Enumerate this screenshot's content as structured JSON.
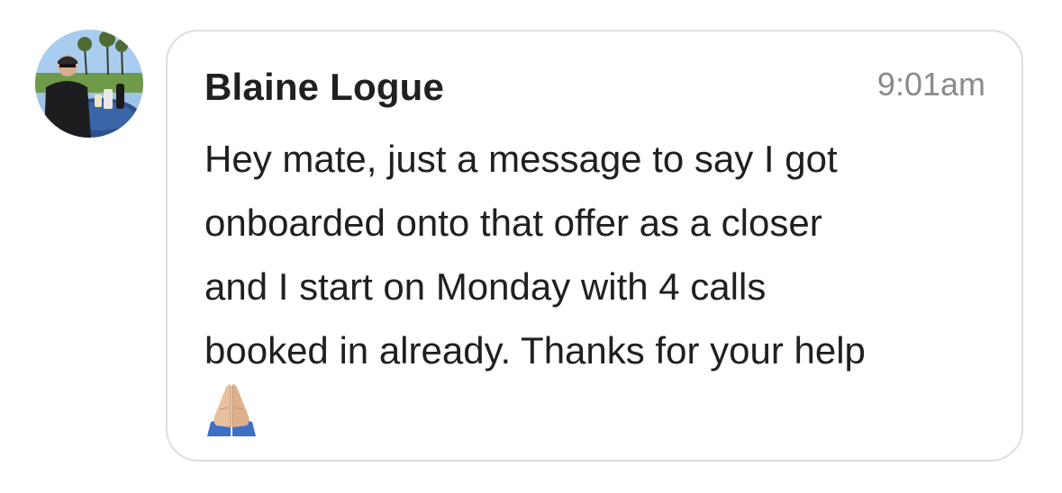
{
  "message": {
    "sender_name": "Blaine Logue",
    "timestamp": "9:01am",
    "text_lines": [
      "Hey mate, just a message to say I got",
      "onboarded onto that offer as a closer",
      "and I start on Monday with 4 calls",
      "booked in already. Thanks for your help"
    ],
    "emoji": "folded-hands",
    "avatar_icon": "user-avatar-photo"
  },
  "colors": {
    "bubble_border": "#dedede",
    "text": "#202020",
    "timestamp": "#8a8a8a"
  }
}
